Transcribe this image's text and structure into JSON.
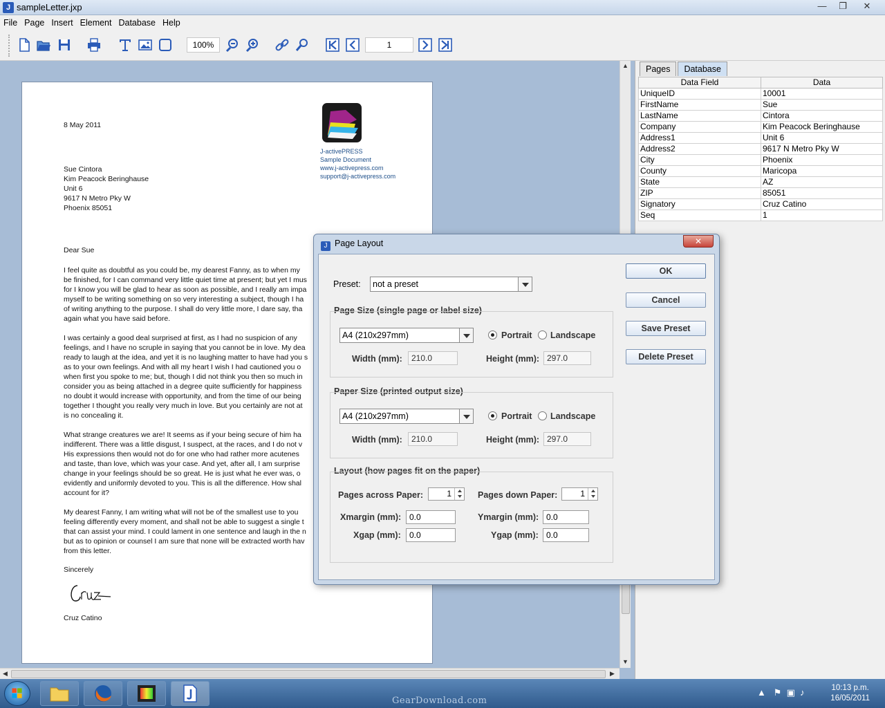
{
  "window": {
    "title": "sampleLetter.jxp",
    "minimize": "—",
    "maximize": "❐",
    "close": "✕",
    "app_icon": "J"
  },
  "menu": [
    "File",
    "Page",
    "Insert",
    "Element",
    "Database",
    "Help"
  ],
  "toolbar": {
    "zoom": "100%",
    "page_number": "1"
  },
  "letter": {
    "date": "8 May 2011",
    "logo_lines": [
      "J-activePRESS",
      "Sample Document",
      "www.j-activepress.com",
      "support@j-activepress.com"
    ],
    "address": [
      "Sue Cintora",
      "Kim Peacock Beringhause",
      "Unit 6",
      "9617 N Metro Pky W",
      "Phoenix 85051"
    ],
    "salutation": "Dear Sue",
    "paragraphs": [
      [
        "I feel quite as doubtful as you could be, my dearest Fanny, as to when my",
        "be finished, for I can command very little quiet time at present; but yet I mus",
        "for I know you will be glad to hear as soon as possible, and I really am impa",
        "myself to be writing something on so very interesting a subject, though I ha",
        "of writing anything to the purpose. I shall do very little more, I dare say, tha",
        "again what you have said before."
      ],
      [
        "I was certainly a good deal surprised at first, as I had no suspicion of any",
        "feelings, and I have no scruple in saying that you cannot be in love. My dea",
        "ready to laugh at the idea, and yet it is no laughing matter to have had you s",
        "as to your own feelings. And with all my heart I wish I had cautioned you o",
        "when first you spoke to me; but, though I did not think you then so much in",
        "consider you as being attached in a degree quite sufficiently for happiness",
        "no doubt it would increase with opportunity, and from the time of our being",
        "together I thought you really very much in love. But you certainly are not at",
        "is no concealing it."
      ],
      [
        "What strange creatures we are! It seems as if your being secure of him ha",
        "indifferent. There was a little disgust, I suspect, at the races, and I do not v",
        "His expressions then would not do for one who had rather more acutenes",
        "and taste, than love, which was your case. And yet, after all, I am surprise",
        "change in your feelings should be so great. He is just what he ever was, o",
        "evidently and uniformly devoted to you. This is all the difference. How shal",
        "account for it?"
      ],
      [
        "My dearest Fanny, I am writing what will not be of the smallest use to you",
        "feeling differently every moment, and shall not be able to suggest a single t",
        "that can assist your mind. I could lament in one sentence and laugh in the n",
        "but as to opinion or counsel I am sure that none will be extracted worth hav",
        "from this letter."
      ]
    ],
    "closing": "Sincerely",
    "signer": "Cruz Catino"
  },
  "panel": {
    "tabs": [
      "Pages",
      "Database"
    ],
    "columns": [
      "Data Field",
      "Data"
    ],
    "rows": [
      [
        "UniqueID",
        "10001"
      ],
      [
        "FirstName",
        "Sue"
      ],
      [
        "LastName",
        "Cintora"
      ],
      [
        "Company",
        "Kim Peacock Beringhause"
      ],
      [
        "Address1",
        "Unit 6"
      ],
      [
        "Address2",
        "9617 N Metro Pky W"
      ],
      [
        "City",
        "Phoenix"
      ],
      [
        "County",
        "Maricopa"
      ],
      [
        "State",
        "AZ"
      ],
      [
        "ZIP",
        "85051"
      ],
      [
        "Signatory",
        "Cruz Catino"
      ],
      [
        "Seq",
        "1"
      ]
    ]
  },
  "dialog": {
    "title": "Page Layout",
    "close": "✕",
    "preset_label": "Preset:",
    "preset_value": "not a preset",
    "page_size_title": "Page Size (single page or label size)",
    "page_size_value": "A4 (210x297mm)",
    "paper_size_title": "Paper Size (printed output size)",
    "paper_size_value": "A4 (210x297mm)",
    "portrait": "Portrait",
    "landscape": "Landscape",
    "width_label": "Width (mm):",
    "height_label": "Height (mm):",
    "page_width": "210.0",
    "page_height": "297.0",
    "paper_width": "210.0",
    "paper_height": "297.0",
    "layout_title": "Layout (how pages fit on the paper)",
    "pages_across_label": "Pages across Paper:",
    "pages_across": "1",
    "pages_down_label": "Pages down Paper:",
    "pages_down": "1",
    "xmargin_label": "Xmargin (mm):",
    "xmargin": "0.0",
    "ymargin_label": "Ymargin (mm):",
    "ymargin": "0.0",
    "xgap_label": "Xgap (mm):",
    "xgap": "0.0",
    "ygap_label": "Ygap (mm):",
    "ygap": "0.0",
    "buttons": {
      "ok": "OK",
      "cancel": "Cancel",
      "save": "Save Preset",
      "delete": "Delete Preset"
    }
  },
  "taskbar": {
    "time": "10:13 p.m.",
    "date": "16/05/2011",
    "watermark": "GearDownload.com"
  }
}
